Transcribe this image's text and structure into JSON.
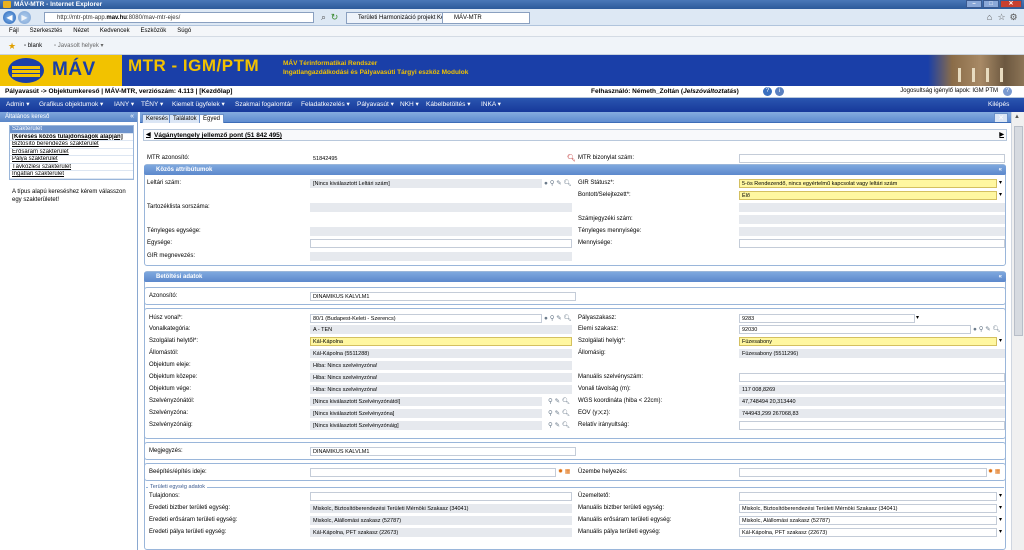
{
  "window": {
    "title": "MÁV-MTR - Internet Explorer"
  },
  "browser": {
    "url_prefix": "http://mtr-ptm-app.",
    "url_host": "mav.hu",
    "url_rest": ":8080/mav-mtr-ejes/",
    "tabs": [
      "Területi Harmonizáció projekt Ke...",
      "MÁV-MTR"
    ],
    "menu": [
      "Fájl",
      "Szerkesztés",
      "Nézet",
      "Kedvencek",
      "Eszközök",
      "Súgó"
    ],
    "favorites": [
      "blank",
      "Javasolt helyek"
    ]
  },
  "banner": {
    "logo_text": "MÁV",
    "title": "MTR - IGM/PTM",
    "sub1": "MÁV Térinformatikai Rendszer",
    "sub2": "Ingatlangazdálkodási és Pályavasúti Tárgyi eszköz Modulok",
    "sub3": ""
  },
  "info": {
    "path": "Pályavasút -> Objektumkereső | MÁV-MTR, verziószám: 4.113 | [Kezdőlap]",
    "user_prefix": "Felhasználó: Németh_Zoltán (",
    "user_italic": "Jelszóváltoztatás",
    "user_suffix": ")",
    "rights": "Jogosultság igénylő lapok: IGM PTM"
  },
  "main_menu": {
    "items": [
      "Admin ▾",
      "Grafikus objektumok ▾",
      "IANY ▾",
      "TÉNY ▾",
      "Kiemelt ügyfelek ▾",
      "Szakmai fogalomtár",
      "Feladatkezelés ▾",
      "Pályavasút ▾",
      "NKH ▾",
      "Kábelbetöltés ▾",
      "INKA ▾"
    ],
    "logout": "Kilépés"
  },
  "left": {
    "header": "Általános kereső",
    "items": [
      "Szakterület",
      "[Keresés közös tulajdonságok alapján]",
      "Biztosító berendezés szakterület",
      "Erősáram szakterület",
      "Pálya szakterület",
      "Távközlési szakterület",
      "Ingatlan szakterület"
    ],
    "message": "A típus alapú kereséshez kérem válasszon egy szakterületet!"
  },
  "tabs": [
    "Keresés",
    "Találatok",
    "Egyed"
  ],
  "record_title": "Vágánytengely jellemző pont (51 842 495)",
  "top": {
    "mtr_azon_label": "MTR azonosító:",
    "mtr_azon_value": "51842495",
    "mtr_biz_label": "MTR bizonylat szám:"
  },
  "kozos": {
    "header": "Közös attribútumok",
    "leltari_label": "Leltári szám:",
    "leltari_value": "[Nincs kiválasztott Leltári szám]",
    "gir_status_label": "GIR Státusz*:",
    "gir_status_value": "5-ös Rendezendő, nincs egyértelmű kapcsolat vagy leltári szám",
    "bontott_label": "Bontott/Selejtezett*:",
    "bontott_value": "Élő",
    "tartozek_label": "Tartozéklista sorszáma:",
    "szamjegyzeki_label": "Számjegyzéki szám:",
    "teny_egys_label": "Tényleges egysége:",
    "teny_menny_label": "Tényleges mennyisége:",
    "egysege_label": "Egysége:",
    "mennyisege_label": "Mennyisége:",
    "gir_megnev_label": "GIR megnevezés:"
  },
  "betoltesi": {
    "header": "Betöltési adatok",
    "azonosito_label": "Azonosító:",
    "azonosito_value": "DINAMIKUS KALVLM1"
  },
  "rows": [
    {
      "l_label": "Húsz vonal*:",
      "l_value": "80/1 (Budapest-Keleti - Szerencs)",
      "r_label": "Pályaszakasz:",
      "r_value": "9283"
    },
    {
      "l_label": "Vonalkategória:",
      "l_value": "A - TEN",
      "r_label": "Elemi szakasz:",
      "r_value": "92030"
    },
    {
      "l_label": "Szolgálati helytől*:",
      "l_value": "Kál-Kápolna",
      "r_label": "Szolgálati helyig*:",
      "r_value": "Füzesabony"
    },
    {
      "l_label": "Állomástól:",
      "l_value": "Kál-Kápolna (5511288)",
      "r_label": "Állomásig:",
      "r_value": "Füzesabony (5511296)"
    },
    {
      "l_label": "Objektum eleje:",
      "l_value": "Hiba: Nincs szelvényzóna!",
      "r_label": "",
      "r_value": ""
    },
    {
      "l_label": "Objektum közepe:",
      "l_value": "Hiba: Nincs szelvényzóna!",
      "r_label": "Manuális szelvényszám:",
      "r_value": ""
    },
    {
      "l_label": "Objektum vége:",
      "l_value": "Hiba: Nincs szelvényzóna!",
      "r_label": "Vonali távolság (m):",
      "r_value": "117 008,8269"
    },
    {
      "l_label": "Szelvényzónától:",
      "l_value": "[Nincs kiválasztott Szelvényzónától]",
      "r_label": "WGS koordináta (hiba < 22cm):",
      "r_value": "47,748494   20,313440"
    },
    {
      "l_label": "Szelvényzóna:",
      "l_value": "[Nincs kiválasztott Szelvényzóna]",
      "r_label": "EOV (y;x;z):",
      "r_value": "744943,299    267068,83"
    },
    {
      "l_label": "Szelvényzónáig:",
      "l_value": "[Nincs kiválasztott Szelvényzónáig]",
      "r_label": "Relatív irányultság:",
      "r_value": ""
    }
  ],
  "megjegyzes_label": "Megjegyzés:",
  "megjegyzes_value": "DINAMIKUS KALVLM1",
  "beepites_label": "Beépítés/építés ideje:",
  "uzembe_label": "Üzembe helyezés:",
  "teruleti": {
    "group": "Területi egység adatok",
    "tulajdonos_label": "Tulajdonos:",
    "uzemelteto_label": "Üzemeltető:",
    "rows": [
      {
        "l_label": "Eredeti biztber területi egység:",
        "l_value": "Miskolc, Biztosítóberendezési Területi Mérnöki Szakasz (34041)",
        "r_label": "Manuális biztber területi egység:",
        "r_value": "Miskolc, Biztosítóberendezési Területi Mérnöki Szakasz (34041)"
      },
      {
        "l_label": "Eredeti erősáram területi egység:",
        "l_value": "Miskolc, Alállomási szakasz (52787)",
        "r_label": "Manuális erősáram területi egység:",
        "r_value": "Miskolc, Alállomási szakasz (52787)"
      },
      {
        "l_label": "Eredeti pálya területi egység:",
        "l_value": "Kál-Kápolna, PFT szakasz (22673)",
        "r_label": "Manuális pálya területi egység:",
        "r_value": "Kál-Kápolna, PFT szakasz (22673)"
      }
    ]
  },
  "colors": {
    "accent": "#1a3fa8",
    "brand_yellow": "#f2c200",
    "required": "#fff7a0"
  }
}
